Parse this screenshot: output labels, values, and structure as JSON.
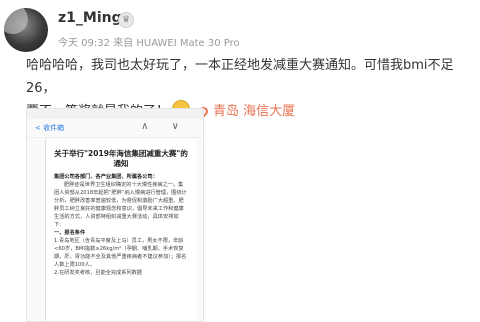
{
  "post": {
    "username": "z1_Ming",
    "badge_icon": "vip-badge-icon",
    "time": "今天 09:32",
    "source": "来自 HUAWEI Mate 30 Pro",
    "text_line1": "哈哈哈哈，我司也太好玩了，一本正经地发减重大赛通知。可惜我bmi不足26，",
    "text_line2": "要不一等奖就是我的了！",
    "emoji": "laughing-emoji",
    "location": "青岛 海信大厦",
    "location_color": "#eb7350"
  },
  "screenshot": {
    "nav_back": "收件箱",
    "nav_arrows": "∧ ∨",
    "doc_title": "关于举行\"2019年海信集团减重大赛\"的通知",
    "salutation": "集团公司各部门、各产业集团、所属各公司：",
    "para1": "肥胖症是世界卫生组织确定的十大慢性疾病之一。集团人资部从2018年起把“肥胖”纳入慢病进行管理，围绕计分析，肥胖改善率普遍较低，为督促和激励广大超重、肥胖员工树立良好的健康观念和意识，倡导未来工作和健康生活的方式，人资部特组织减重大赛活动，具体安排如下：",
    "section1": "一、报名条件",
    "item1": "1.青岛地区（含青岛平度及上马）员工，男女不限，年龄<60岁，BMI指数≥26kg/m²（孕期、哺乳期、手术恢复期、肝、肾功能不全及其他严重疾病者不建议参加）；报名人数上限100人。",
    "item2": "2.在研发奖考核，且能全完成系列数据"
  }
}
